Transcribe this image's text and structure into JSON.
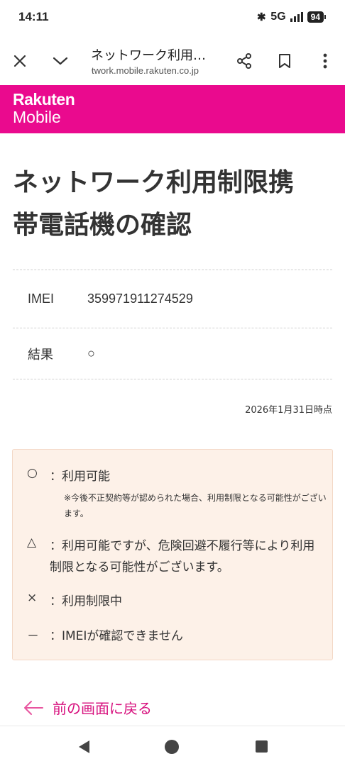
{
  "status_bar": {
    "time": "14:11",
    "network": "5G",
    "battery": "94"
  },
  "browser": {
    "page_title": "ネットワーク利用…",
    "url": "network.mobile.rakuten.co.jp"
  },
  "brand": {
    "logo_line1": "Rakuten",
    "logo_line2": "Mobile",
    "color": "#ea0a8e"
  },
  "main": {
    "title_line1": "ネットワーク利用制限携",
    "title_line2": "帯電話機の確認",
    "rows": [
      {
        "label": "IMEI",
        "value": "359971911274529"
      },
      {
        "label": "結果",
        "value": "○"
      }
    ],
    "timestamp": "2026年1月31日時点"
  },
  "legend": {
    "available_symbol": "○",
    "available_text": "：利用可能",
    "available_note": "※今後不正契約等が認められた場合、利用制限となる可能性がございます。",
    "warning_symbol": "△",
    "warning_text": "：利用可能ですが、危険回避不履行等により利用制限となる可能性がございます。",
    "restricted_symbol": "×",
    "restricted_text": "：利用制限中",
    "unknown_symbol": "－",
    "unknown_text": "：IMEIが確認できません"
  },
  "back_link": {
    "label": "前の画面に戻る",
    "color": "#d7117e"
  },
  "icons": {
    "toolbar": [
      "close-icon",
      "chevron-down-icon",
      "share-icon",
      "bookmark-icon",
      "more-vert-icon"
    ],
    "nav": [
      "back-triangle-icon",
      "home-circle-icon",
      "recents-square-icon"
    ]
  }
}
